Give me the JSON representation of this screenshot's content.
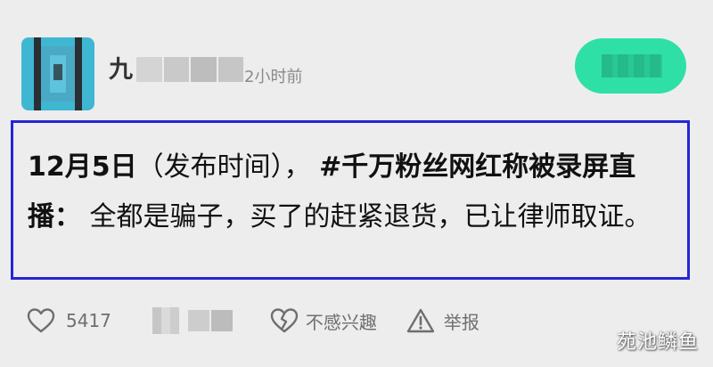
{
  "header": {
    "user_name_visible": "九",
    "post_time": "2小时前",
    "avatar_icon": "pixelated-avatar",
    "follow_button": {
      "label": "",
      "color": "#2fe0a6"
    }
  },
  "post": {
    "date": "12月5日",
    "after_date": "（发布时间），",
    "topic": "#千万粉丝网红称被录屏直播：",
    "body": "全都是骗子，买了的赶紧退货，已让律师取证。",
    "highlight_border_color": "#2525d9"
  },
  "actions": {
    "like": {
      "icon": "heart-icon",
      "count": "5417"
    },
    "blurred_action": {
      "icon": "pixelated-icon"
    },
    "dislike": {
      "icon": "broken-heart-icon",
      "label": "不感兴趣"
    },
    "report": {
      "icon": "warning-triangle-icon",
      "label": "举报"
    }
  },
  "watermark": "苑池鳞鱼"
}
